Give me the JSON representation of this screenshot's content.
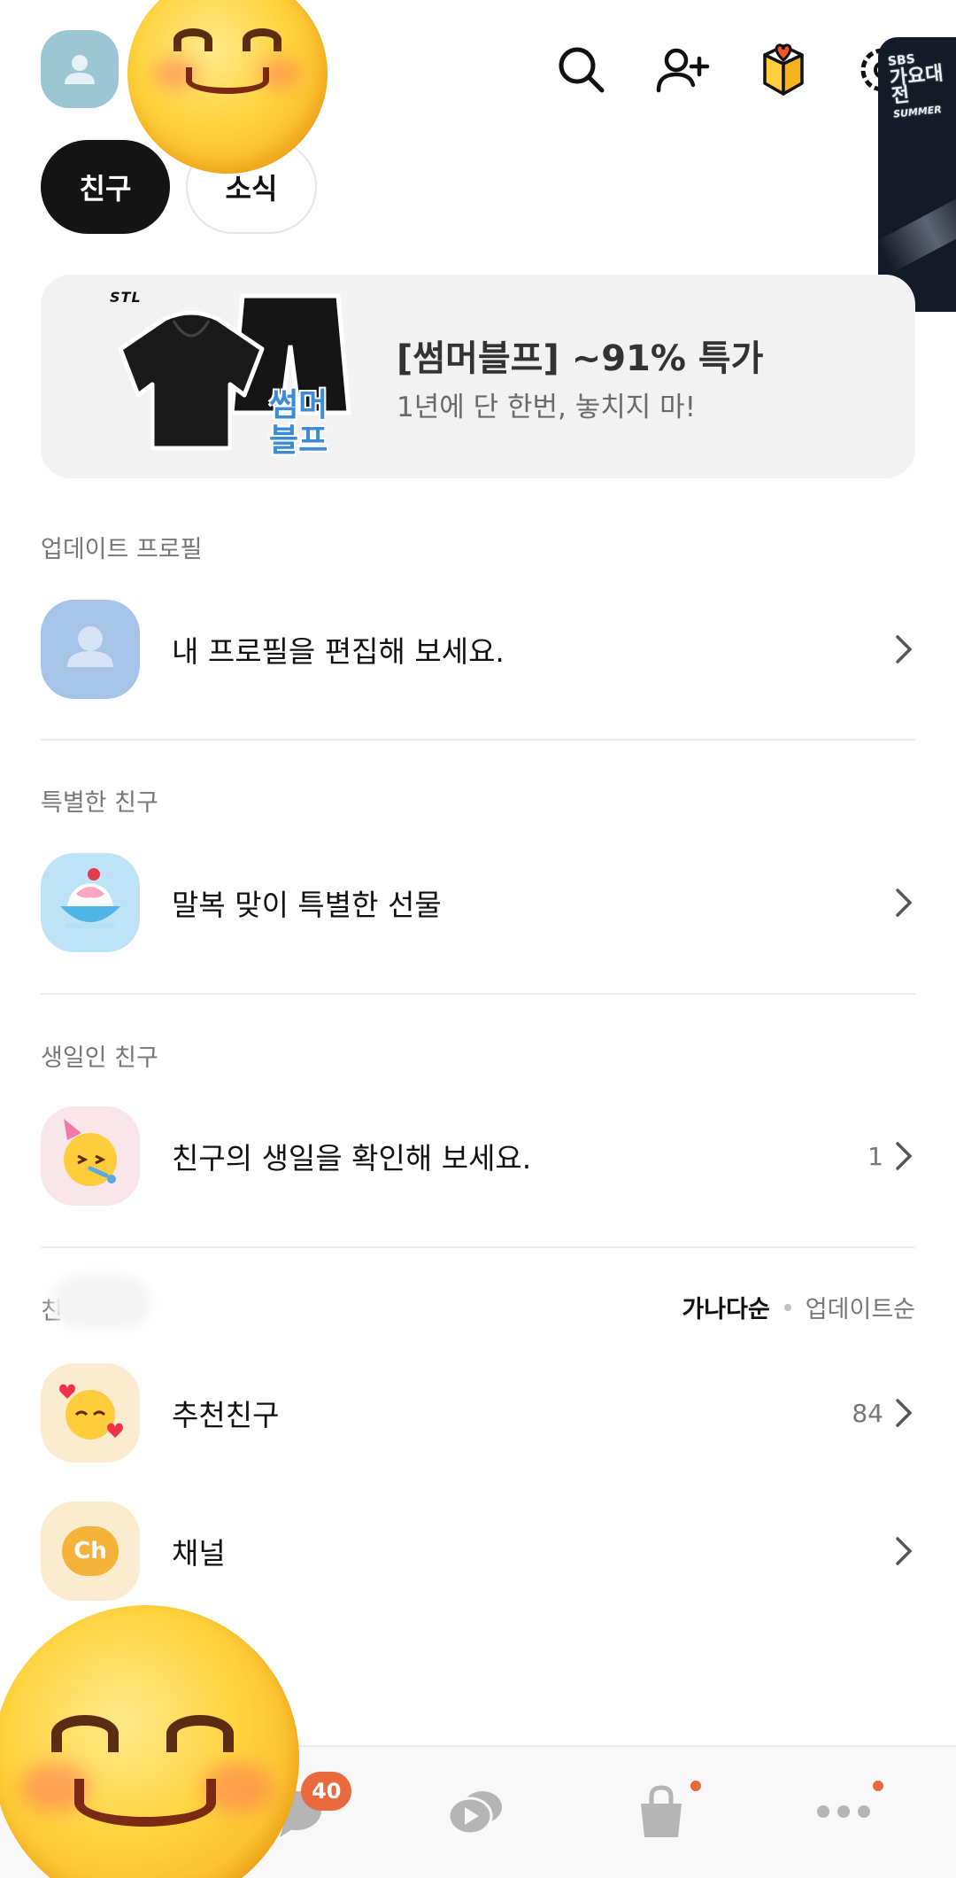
{
  "header": {
    "icons": [
      "profile-avatar",
      "search-icon",
      "add-friend-icon",
      "gift-icon",
      "settings-icon"
    ],
    "sticker_logo_line1": "SBS",
    "sticker_logo_line2": "가요대전",
    "sticker_logo_line3": "SUMMER"
  },
  "tabs": [
    {
      "label": "친구",
      "active": true
    },
    {
      "label": "소식",
      "active": false
    }
  ],
  "banner": {
    "brand": "STL",
    "sticker_line1": "썸머",
    "sticker_line2": "블프",
    "title": "[썸머블프] ~91% 특가",
    "subtitle": "1년에 단 한번, 놓치지 마!"
  },
  "sections": {
    "update_profile": {
      "label": "업데이트 프로필",
      "item": "내 프로필을 편집해 보세요."
    },
    "special_friends": {
      "label": "특별한 친구",
      "item": "말복 맞이 특별한 선물"
    },
    "birthday_friends": {
      "label": "생일인 친구",
      "item": "친구의 생일을 확인해 보세요.",
      "count": "1"
    },
    "friends": {
      "label": "친",
      "sort_active": "가나다순",
      "sort_inactive": "업데이트순",
      "items": [
        {
          "label": "추천친구",
          "count": "84"
        },
        {
          "label": "채널",
          "count": ""
        }
      ],
      "channel_icon_text": "Ch"
    }
  },
  "bottom_nav": {
    "chat_badge": "40",
    "items": [
      "friends-tab",
      "chat-tab",
      "openchat-tab",
      "shopping-tab",
      "more-tab"
    ]
  },
  "colors": {
    "accent": "#e86a3e",
    "tab_active_bg": "#141414",
    "banner_bg": "#f2f2f2"
  }
}
